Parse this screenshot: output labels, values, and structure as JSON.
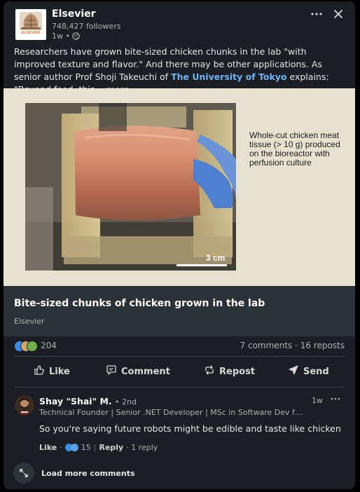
{
  "author": {
    "name": "Elsevier",
    "followers": "748,427 followers",
    "time": "1w •",
    "logo_text": "ELSEVIER"
  },
  "post": {
    "text_before": "Researchers have grown bite-sized chicken chunks in the lab \"with improved texture and flavor.\" And there may be other applications. As senior author Prof Shoji Takeuchi of ",
    "org": "The University of Tokyo",
    "text_after": " explains: \"Beyond food, this ",
    "more": "…more"
  },
  "image": {
    "caption": "Whole-cut chicken meat tissue (> 10 g) produced on the bioreactor with perfusion culture",
    "scale": "3 cm"
  },
  "link_card": {
    "title": "Bite-sized chunks of chicken grown in the lab",
    "source": "Elsevier"
  },
  "stats": {
    "reactions": "204",
    "comments_reposts": "7 comments · 16 reposts"
  },
  "actions": {
    "like": "Like",
    "comment": "Comment",
    "repost": "Repost",
    "send": "Send"
  },
  "comment": {
    "name": "Shay \"Shai\" M.",
    "degree": "• 2nd",
    "headline": "Technical Founder | Senior .NET Developer | MSc in Software Dev from ...",
    "time": "1w",
    "body": "So you're saying future robots might be edible and taste like chicken",
    "like": "Like",
    "sep": "·",
    "reaction_count": "15",
    "reply": "Reply",
    "replies": "· 1 reply"
  },
  "load_more": "Load more comments",
  "colors": {
    "card_bg": "#1b1f23",
    "link_blue": "#70b5f9",
    "like_blue": "#378fe9",
    "celebrate_green": "#6dae4f",
    "support_purple": "#a872e8"
  }
}
